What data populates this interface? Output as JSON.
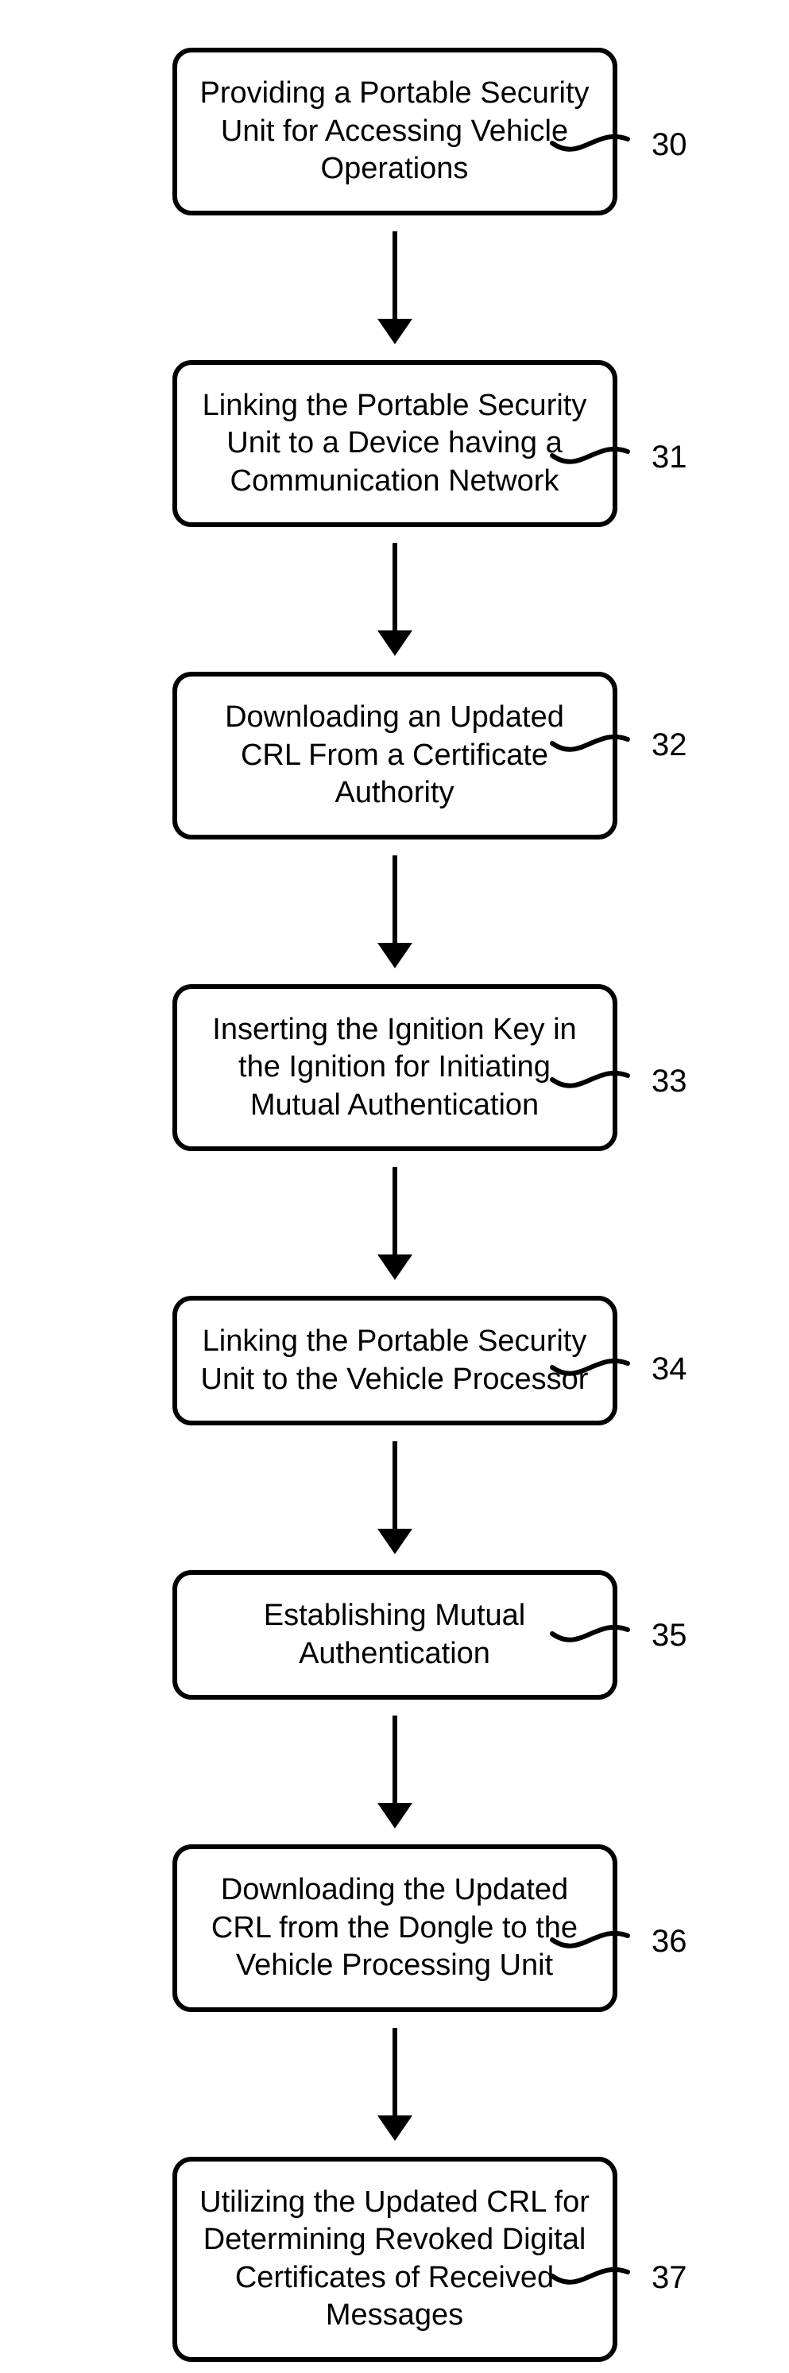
{
  "flow": {
    "steps": [
      {
        "id": 30,
        "text": "Providing a Portable Security Unit for Accessing Vehicle Operations",
        "label": "30"
      },
      {
        "id": 31,
        "text": "Linking the Portable Security Unit to a Device having a Communication Network",
        "label": "31"
      },
      {
        "id": 32,
        "text": "Downloading an Updated CRL From a Certificate Authority",
        "label": "32"
      },
      {
        "id": 33,
        "text": "Inserting the Ignition Key in the Ignition for Initiating Mutual Authentication",
        "label": "33"
      },
      {
        "id": 34,
        "text": "Linking the Portable Security Unit to the Vehicle Processor",
        "label": "34"
      },
      {
        "id": 35,
        "text": "Establishing Mutual Authentication",
        "label": "35"
      },
      {
        "id": 36,
        "text": "Downloading the Updated CRL from the Dongle to the Vehicle Processing Unit",
        "label": "36"
      },
      {
        "id": 37,
        "text": "Utilizing the Updated CRL for Determining Revoked Digital Certificates of Received Messages",
        "label": "37"
      }
    ]
  }
}
